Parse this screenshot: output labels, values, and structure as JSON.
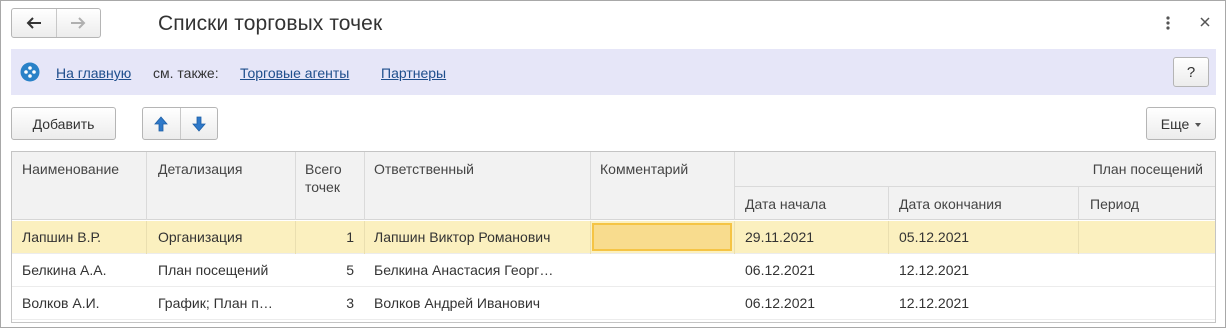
{
  "window": {
    "title": "Списки торговых точек"
  },
  "infobar": {
    "home_link": "На главную",
    "see_also": "см. также:",
    "links": [
      "Торговые агенты",
      "Партнеры"
    ],
    "help_label": "?"
  },
  "toolbar": {
    "add_label": "Добавить",
    "more_label": "Еще"
  },
  "table": {
    "headers": {
      "name": "Наименование",
      "detail": "Детализация",
      "total_line1": "Всего",
      "total_line2": "точек",
      "responsible": "Ответственный",
      "comment": "Комментарий",
      "plan_group": "План посещений",
      "start_date": "Дата начала",
      "end_date": "Дата окончания",
      "period": "Период"
    },
    "rows": [
      {
        "name": "Лапшин В.Р.",
        "detail": "Организация",
        "total": "1",
        "responsible": "Лапшин Виктор Романович",
        "comment": "",
        "start_date": "29.11.2021",
        "end_date": "05.12.2021",
        "period": "",
        "selected": true
      },
      {
        "name": "Белкина А.А.",
        "detail": "План посещений",
        "total": "5",
        "responsible": "Белкина Анастасия Георг…",
        "comment": "",
        "start_date": "06.12.2021",
        "end_date": "12.12.2021",
        "period": "",
        "selected": false
      },
      {
        "name": "Волков А.И.",
        "detail": "График; План п…",
        "total": "3",
        "responsible": "Волков Андрей Иванович",
        "comment": "",
        "start_date": "06.12.2021",
        "end_date": "12.12.2021",
        "period": "",
        "selected": false
      }
    ]
  },
  "colors": {
    "infobar_bg": "#e6e6f8",
    "selected_row": "#fbf0bf",
    "active_cell": "#f8dc8e",
    "arrow_blue": "#2f79c9",
    "link": "#1e4e8c"
  }
}
